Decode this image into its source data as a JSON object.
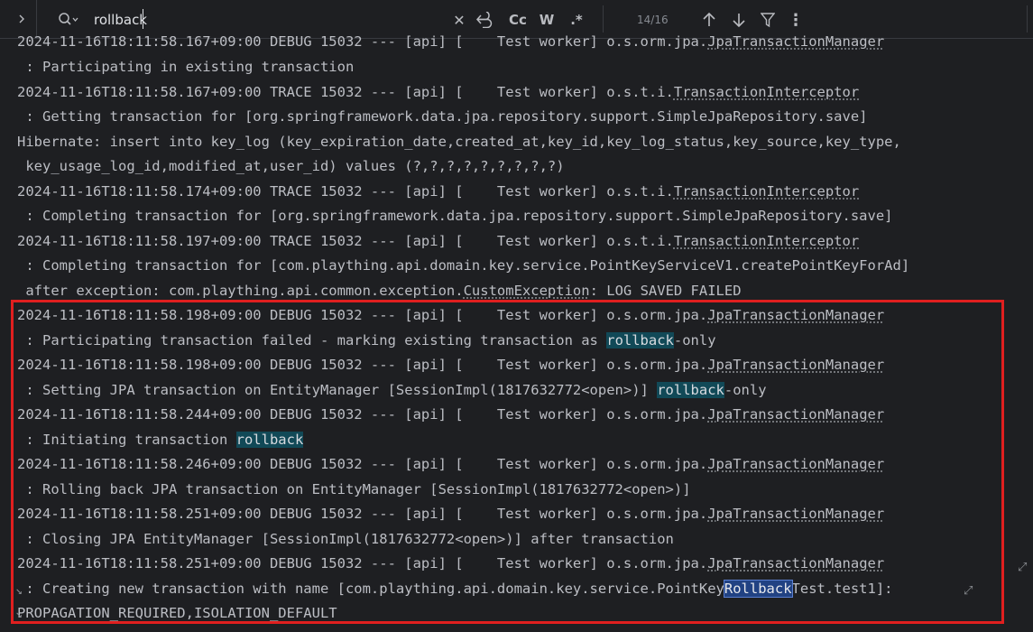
{
  "search": {
    "query": "rollback",
    "match_count": "14/16",
    "buttons": {
      "case": "Cc",
      "word": "W",
      "regex": ".*"
    }
  },
  "icons": {
    "expand": "chevron-right-icon",
    "search": "search-history-icon",
    "clear": "close-icon",
    "replace": "replace-icon",
    "prev": "arrow-up-icon",
    "next": "arrow-down-icon",
    "filter": "filter-icon",
    "more": "more-vertical-icon",
    "wrap": "soft-wrap-icon"
  },
  "colors": {
    "match_highlight": "#114957",
    "current_match": "#214283",
    "selection_box": "#e01f1f"
  },
  "console": {
    "lines": [
      "2024-11-16T18:11:58.167+09:00 DEBUG 15032 --- [api] [    Test worker] o.s.orm.jpa.JpaTransactionManager",
      " : Participating in existing transaction",
      "2024-11-16T18:11:58.167+09:00 TRACE 15032 --- [api] [    Test worker] o.s.t.i.TransactionInterceptor",
      " : Getting transaction for [org.springframework.data.jpa.repository.support.SimpleJpaRepository.save]",
      "Hibernate: insert into key_log (key_expiration_date,created_at,key_id,key_log_status,key_source,key_type,",
      " key_usage_log_id,modified_at,user_id) values (?,?,?,?,?,?,?,?,?)",
      "2024-11-16T18:11:58.174+09:00 TRACE 15032 --- [api] [    Test worker] o.s.t.i.TransactionInterceptor",
      " : Completing transaction for [org.springframework.data.jpa.repository.support.SimpleJpaRepository.save]",
      "2024-11-16T18:11:58.197+09:00 TRACE 15032 --- [api] [    Test worker] o.s.t.i.TransactionInterceptor",
      " : Completing transaction for [com.plaything.api.domain.key.service.PointKeyServiceV1.createPointKeyForAd]",
      " after exception: com.plaything.api.common.exception.CustomException: LOG SAVED FAILED",
      "2024-11-16T18:11:58.198+09:00 DEBUG 15032 --- [api] [    Test worker] o.s.orm.jpa.JpaTransactionManager",
      " : Participating transaction failed - marking existing transaction as rollback-only",
      "2024-11-16T18:11:58.198+09:00 DEBUG 15032 --- [api] [    Test worker] o.s.orm.jpa.JpaTransactionManager",
      " : Setting JPA transaction on EntityManager [SessionImpl(1817632772<open>)] rollback-only",
      "2024-11-16T18:11:58.244+09:00 DEBUG 15032 --- [api] [    Test worker] o.s.orm.jpa.JpaTransactionManager",
      " : Initiating transaction rollback",
      "2024-11-16T18:11:58.246+09:00 DEBUG 15032 --- [api] [    Test worker] o.s.orm.jpa.JpaTransactionManager",
      " : Rolling back JPA transaction on EntityManager [SessionImpl(1817632772<open>)]",
      "2024-11-16T18:11:58.251+09:00 DEBUG 15032 --- [api] [    Test worker] o.s.orm.jpa.JpaTransactionManager",
      " : Closing JPA EntityManager [SessionImpl(1817632772<open>)] after transaction",
      "2024-11-16T18:11:58.251+09:00 DEBUG 15032 --- [api] [    Test worker] o.s.orm.jpa.JpaTransactionManager",
      " : Creating new transaction with name [com.plaything.api.domain.key.service.PointKeyRollbackTest.test1]:",
      "PROPAGATION_REQUIRED,ISOLATION_DEFAULT"
    ]
  }
}
